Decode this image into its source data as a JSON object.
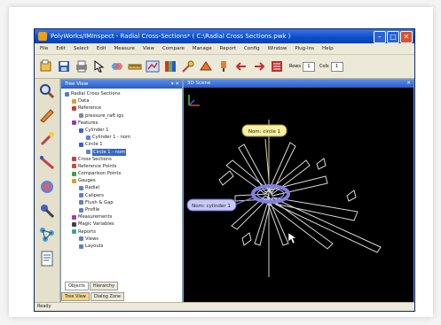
{
  "window": {
    "title": "PolyWorks/IMInspect - Radial Cross-Sections* ( C:\\Radial Cross Sections.pwk )"
  },
  "menu": [
    "File",
    "Edit",
    "Select",
    "Edit",
    "Measure",
    "View",
    "Compare",
    "Manage",
    "Report",
    "Config",
    "Window",
    "Plug-ins",
    "Help"
  ],
  "toolbar": {
    "icons": [
      "open-project-icon",
      "save-icon",
      "print-icon",
      "select-icon",
      "align-icon",
      "measure-icon",
      "compare-icon",
      "color-map-icon",
      "probe-icon",
      "shape-icon",
      "probe-device-icon",
      "arrow-left-icon",
      "arrow-right-icon",
      "sequence-icon"
    ],
    "spin1_label": "Rows",
    "spin1_value": "1",
    "spin2_label": "Cols",
    "spin2_value": "1"
  },
  "tree_panel": {
    "header": "Tree View",
    "controls": "▾ ✕",
    "items": [
      {
        "label": "Radial Cross Sections",
        "indent": 0,
        "color": "#5a7ad8"
      },
      {
        "label": "Data",
        "indent": 1,
        "color": "#d8a030"
      },
      {
        "label": "Reference",
        "indent": 1,
        "color": "#c04040"
      },
      {
        "label": "pressure_raft.igs",
        "indent": 2,
        "color": "#8080c0"
      },
      {
        "label": "Features",
        "indent": 1,
        "color": "#9040a0"
      },
      {
        "label": "Cylinder 1",
        "indent": 2,
        "color": "#4060c0"
      },
      {
        "label": "Cylinder 1 - nom",
        "indent": 3,
        "color": "#6080d0"
      },
      {
        "label": "Circle 1",
        "indent": 2,
        "color": "#4060c0"
      },
      {
        "label": "Circle 1 - nom",
        "indent": 3,
        "color": "#6080d0",
        "selected": true
      },
      {
        "label": "Cross Sections",
        "indent": 1,
        "color": "#c04040"
      },
      {
        "label": "Reference Points",
        "indent": 1,
        "color": "#c05040"
      },
      {
        "label": "Comparison Points",
        "indent": 1,
        "color": "#40a040"
      },
      {
        "label": "Gauges",
        "indent": 1,
        "color": "#d0a030"
      },
      {
        "label": "Radial",
        "indent": 2,
        "color": "#6080c0"
      },
      {
        "label": "Calipers",
        "indent": 2,
        "color": "#6080c0"
      },
      {
        "label": "Flush & Gap",
        "indent": 2,
        "color": "#6080c0"
      },
      {
        "label": "Profile",
        "indent": 2,
        "color": "#6080c0"
      },
      {
        "label": "Measurements",
        "indent": 1,
        "color": "#a040a0"
      },
      {
        "label": "Magic Variables",
        "indent": 1,
        "color": "#404040"
      },
      {
        "label": "Reports",
        "indent": 1,
        "color": "#40a0a0"
      },
      {
        "label": "Views",
        "indent": 2,
        "color": "#6080c0"
      },
      {
        "label": "Layouts",
        "indent": 2,
        "color": "#6080c0"
      }
    ],
    "tabs_top": [
      "Objects",
      "Hierarchy"
    ],
    "tabs_bottom": [
      "Tree View",
      "Dialog Zone"
    ]
  },
  "view_panel": {
    "header": "3D Scene",
    "annotations": {
      "top": "Nom: circle 1",
      "left": "Nom: cylinder 1"
    },
    "axis": {
      "x": "x",
      "y": "y",
      "z": "z"
    }
  },
  "sidebar_icons": [
    "magnifier-icon",
    "edit-icon",
    "wand-icon",
    "measure-icon",
    "compare-icon",
    "probe-icon",
    "network-icon",
    "report-icon"
  ],
  "status": {
    "text": "Ready"
  }
}
